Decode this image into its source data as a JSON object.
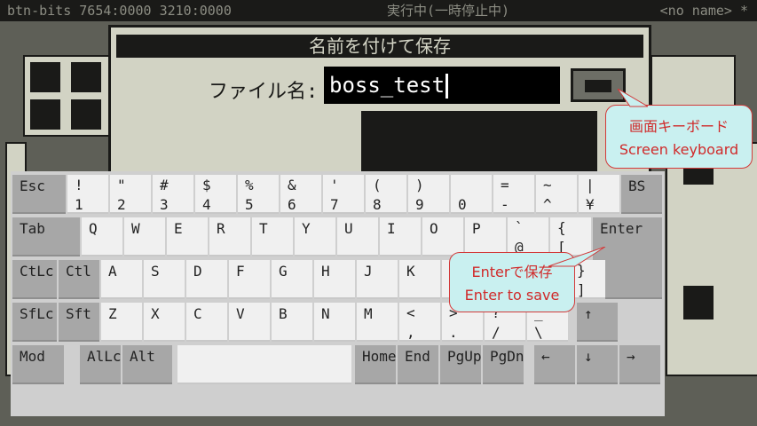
{
  "status_bar": {
    "left": "btn-bits 7654:0000 3210:0000",
    "center": "実行中(一時停止中)",
    "right": "<no name> *"
  },
  "dialog": {
    "title": "名前を付けて保存",
    "filename_label": "ファイル名:",
    "filename_value": "boss_test",
    "keyboard_button_icon": "keyboard-icon"
  },
  "keyboard": {
    "rows": [
      [
        {
          "top": "Esc",
          "mod": true
        },
        {
          "top": "!",
          "bottom": "1"
        },
        {
          "top": "\"",
          "bottom": "2"
        },
        {
          "top": "#",
          "bottom": "3"
        },
        {
          "top": "$",
          "bottom": "4"
        },
        {
          "top": "%",
          "bottom": "5"
        },
        {
          "top": "&",
          "bottom": "6"
        },
        {
          "top": "'",
          "bottom": "7"
        },
        {
          "top": "(",
          "bottom": "8"
        },
        {
          "top": ")",
          "bottom": "9"
        },
        {
          "top": "",
          "bottom": "0"
        },
        {
          "top": "=",
          "bottom": "-"
        },
        {
          "top": "~",
          "bottom": "^"
        },
        {
          "top": "|",
          "bottom": "¥"
        },
        {
          "top": "BS",
          "mod": true
        }
      ],
      [
        {
          "top": "Tab",
          "mod": true
        },
        {
          "top": "Q"
        },
        {
          "top": "W"
        },
        {
          "top": "E"
        },
        {
          "top": "R"
        },
        {
          "top": "T"
        },
        {
          "top": "Y"
        },
        {
          "top": "U"
        },
        {
          "top": "I"
        },
        {
          "top": "O"
        },
        {
          "top": "P"
        },
        {
          "top": "`",
          "bottom": "@"
        },
        {
          "top": "{",
          "bottom": "["
        },
        {
          "top": "Enter",
          "mod": true
        }
      ],
      [
        {
          "top": "CtLc",
          "mod": true
        },
        {
          "top": "Ctl",
          "mod": true
        },
        {
          "top": "A"
        },
        {
          "top": "S"
        },
        {
          "top": "D"
        },
        {
          "top": "F"
        },
        {
          "top": "G"
        },
        {
          "top": "H"
        },
        {
          "top": "J"
        },
        {
          "top": "K"
        },
        {
          "top": "L"
        },
        {
          "top": "+",
          "bottom": ";"
        },
        {
          "top": "*",
          "bottom": ":"
        },
        {
          "top": "}",
          "bottom": "]"
        }
      ],
      [
        {
          "top": "SfLc",
          "mod": true
        },
        {
          "top": "Sft",
          "mod": true
        },
        {
          "top": "Z"
        },
        {
          "top": "X"
        },
        {
          "top": "C"
        },
        {
          "top": "V"
        },
        {
          "top": "B"
        },
        {
          "top": "N"
        },
        {
          "top": "M"
        },
        {
          "top": "<",
          "bottom": ","
        },
        {
          "top": ">",
          "bottom": "."
        },
        {
          "top": "?",
          "bottom": "/"
        },
        {
          "top": "_",
          "bottom": "\\"
        },
        {
          "top": "↑",
          "mod": true
        }
      ],
      [
        {
          "top": "Mod",
          "mod": true
        },
        {
          "top": "AlLc",
          "mod": true
        },
        {
          "top": "Alt",
          "mod": true
        },
        {
          "top": ""
        },
        {
          "top": "Home",
          "mod": true
        },
        {
          "top": "End",
          "mod": true
        },
        {
          "top": "PgUp",
          "mod": true
        },
        {
          "top": "PgDn",
          "mod": true
        },
        {
          "top": "←",
          "mod": true
        },
        {
          "top": "↓",
          "mod": true
        },
        {
          "top": "→",
          "mod": true
        }
      ]
    ]
  },
  "tooltips": {
    "screen_keyboard": {
      "line1": "画面キーボード",
      "line2": "Screen keyboard"
    },
    "enter_save": {
      "line1": "Enterで保存",
      "line2": "Enter to save"
    }
  },
  "colors": {
    "panel": "#d2d3c4",
    "dark": "#1a1a18",
    "key": "#f0f0f0",
    "mod_key": "#a7a7a7",
    "tooltip_bg": "#c9f0f0",
    "tooltip_text": "#d02a2a"
  }
}
